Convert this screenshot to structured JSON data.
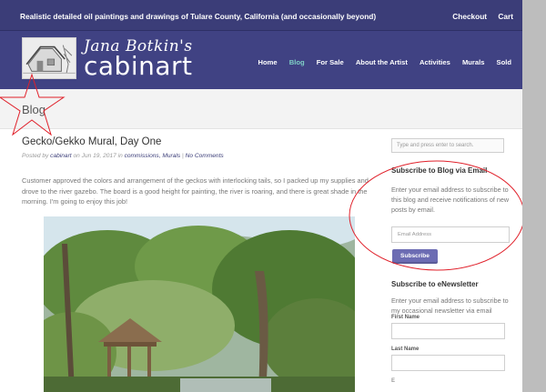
{
  "topbar": {
    "tagline": "Realistic detailed oil paintings and drawings of Tulare County, California (and occasionally beyond)",
    "links": [
      "Checkout",
      "Cart"
    ]
  },
  "logo": {
    "script": "Jana Botkin's",
    "word": "cabinart"
  },
  "nav": {
    "items": [
      "Home",
      "Blog",
      "For Sale",
      "About the Artist",
      "Activities",
      "Murals",
      "Sold"
    ],
    "active": "Blog"
  },
  "band": {
    "title": "Blog"
  },
  "post": {
    "title": "Gecko/Gekko Mural, Day One",
    "meta_prefix": "Posted by",
    "meta_author": "cabinart",
    "meta_on": "on Jun 19, 2017 in",
    "meta_cats": "commissions, Murals",
    "meta_sep": "|",
    "meta_comments": "No Comments",
    "body": "Customer approved the colors and arrangement of the geckos with interlocking tails, so I packed up my supplies and drove to the river gazebo. The board is a good height for painting, the river is roaring, and there is great shade in the morning. I'm going to enjoy this job!"
  },
  "sidebar": {
    "search_placeholder": "Type and press enter to search.",
    "subscribe_blog": {
      "title": "Subscribe to Blog via Email",
      "text": "Enter your email address to subscribe to this blog and receive notifications of new posts by email.",
      "email_placeholder": "Email Address",
      "button": "Subscribe"
    },
    "newsletter": {
      "title": "Subscribe to eNewsletter",
      "text": "Enter your email address to subscribe to my occasional newsletter via email",
      "first_name": "First Name",
      "last_name": "Last Name",
      "email_label": "E"
    }
  },
  "colors": {
    "header": "#404283",
    "topbar": "#3b3d78",
    "nav_active": "#7fd0c6",
    "button": "#6c6cb3",
    "annotation": "#e0202a"
  }
}
